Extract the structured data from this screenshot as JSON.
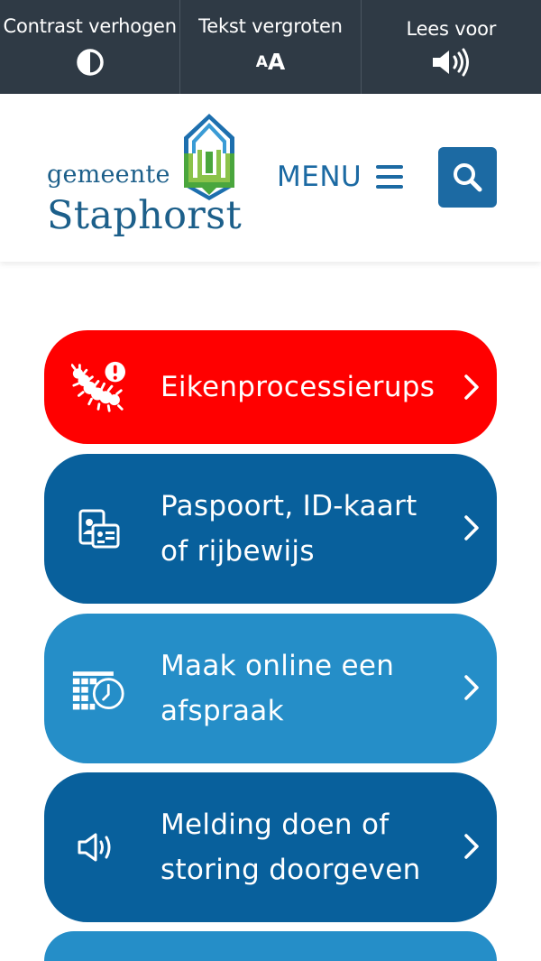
{
  "accessibility_bar": {
    "items": [
      {
        "label": "Contrast verhogen",
        "icon": "contrast-icon"
      },
      {
        "label": "Tekst vergroten",
        "icon": "text-size-icon",
        "icon_text_small": "A",
        "icon_text_big": "A"
      },
      {
        "label": "Lees voor",
        "icon": "speaker-icon"
      }
    ]
  },
  "header": {
    "logo": {
      "line1": "gemeente",
      "line2": "Staphorst"
    },
    "menu_label": "MENU",
    "search_icon": "search-icon"
  },
  "tiles": [
    {
      "label": "Eikenprocessierups",
      "icon": "caterpillar-warning-icon",
      "color": "#ff0000"
    },
    {
      "label": "Paspoort, ID-kaart of rijbewijs",
      "icon": "id-documents-icon",
      "color": "#08609c"
    },
    {
      "label": "Maak online een afspraak",
      "icon": "calendar-clock-icon",
      "color": "#258ec8"
    },
    {
      "label": "Melding doen of storing doorgeven",
      "icon": "megaphone-icon",
      "color": "#08609c"
    },
    {
      "label": "",
      "icon": "",
      "color": "#258ec8"
    }
  ],
  "colors": {
    "top_bar": "#2f3a45",
    "brand_blue": "#1c6aa3",
    "logo_text": "#1c5f8a"
  }
}
